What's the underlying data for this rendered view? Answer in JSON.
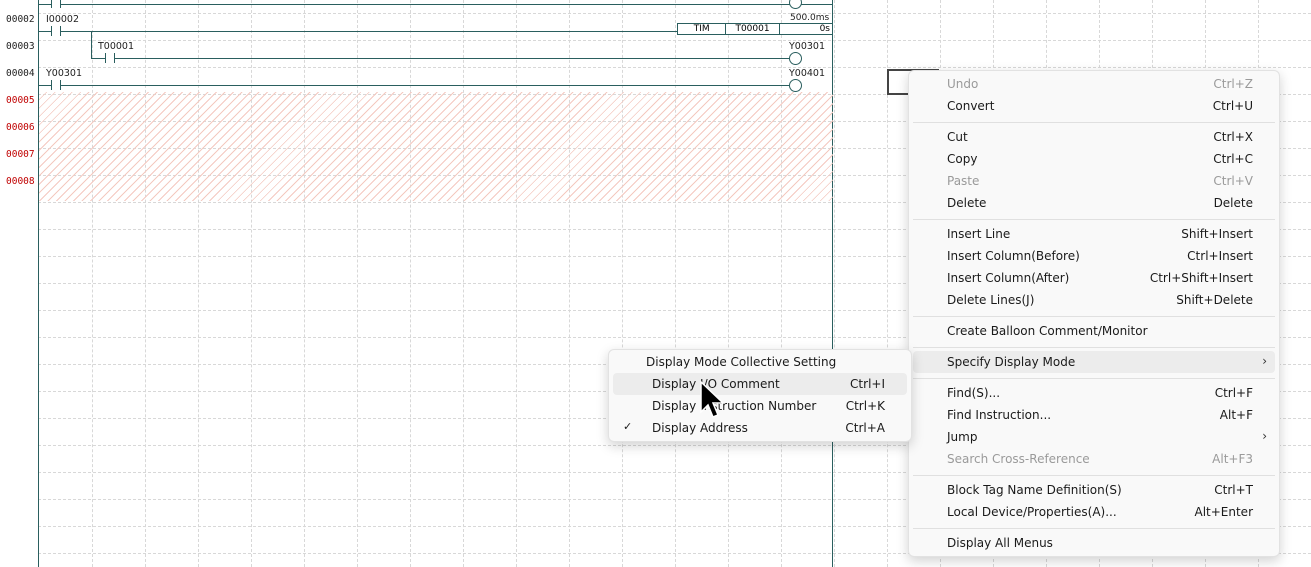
{
  "ladder": {
    "rows": [
      {
        "num": "00002",
        "contact": "I00002",
        "timer": {
          "type": "TIM",
          "device": "T00001",
          "preset": "500.0ms",
          "current": "0s"
        }
      },
      {
        "num": "00003",
        "contact": "T00001",
        "coil": "Y00301"
      },
      {
        "num": "00004",
        "contact": "Y00301",
        "coil": "Y00401"
      },
      {
        "num": "00005"
      },
      {
        "num": "00006"
      },
      {
        "num": "00007"
      },
      {
        "num": "00008"
      }
    ]
  },
  "context_menu": {
    "items": [
      {
        "label": "Undo",
        "shortcut": "Ctrl+Z",
        "disabled": true
      },
      {
        "label": "Convert",
        "shortcut": "Ctrl+U"
      },
      {
        "label": "Cut",
        "shortcut": "Ctrl+X"
      },
      {
        "label": "Copy",
        "shortcut": "Ctrl+C"
      },
      {
        "label": "Paste",
        "shortcut": "Ctrl+V",
        "disabled": true
      },
      {
        "label": "Delete",
        "shortcut": "Delete"
      },
      {
        "label": "Insert Line",
        "shortcut": "Shift+Insert"
      },
      {
        "label": "Insert Column(Before)",
        "shortcut": "Ctrl+Insert"
      },
      {
        "label": "Insert Column(After)",
        "shortcut": "Ctrl+Shift+Insert"
      },
      {
        "label": "Delete Lines(J)",
        "shortcut": "Shift+Delete"
      },
      {
        "label": "Create Balloon Comment/Monitor",
        "shortcut": ""
      },
      {
        "label": "Specify Display Mode",
        "shortcut": ""
      },
      {
        "label": "Find(S)...",
        "shortcut": "Ctrl+F"
      },
      {
        "label": "Find Instruction...",
        "shortcut": "Alt+F"
      },
      {
        "label": "Jump",
        "shortcut": ""
      },
      {
        "label": "Search Cross-Reference",
        "shortcut": "Alt+F3",
        "disabled": true
      },
      {
        "label": "Block Tag Name Definition(S)",
        "shortcut": "Ctrl+T"
      },
      {
        "label": "Local Device/Properties(A)...",
        "shortcut": "Alt+Enter"
      },
      {
        "label": "Display All Menus",
        "shortcut": ""
      }
    ]
  },
  "submenu": {
    "items": [
      {
        "label": "Display Mode Collective Setting",
        "shortcut": ""
      },
      {
        "label": "Display I/O Comment",
        "shortcut": "Ctrl+I"
      },
      {
        "label": "Display Instruction Number",
        "shortcut": "Ctrl+K"
      },
      {
        "label": "Display Address",
        "shortcut": "Ctrl+A",
        "checked": true
      }
    ],
    "check_glyph": "✓"
  },
  "colors": {
    "rail": "#2a5e5e",
    "empty_row": "#c00000",
    "hatch": "#f4c9c0"
  }
}
